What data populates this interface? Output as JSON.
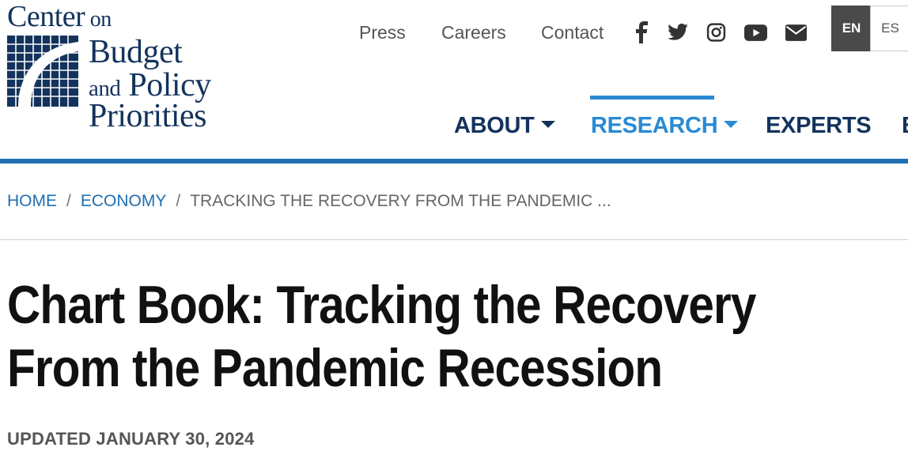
{
  "logo": {
    "line1_main": "Center",
    "line1_small": " on",
    "line2": "Budget",
    "line3_small": "and",
    "line3_main": " Policy",
    "line4": "Priorities"
  },
  "utility_nav": {
    "links": [
      "Press",
      "Careers",
      "Contact"
    ],
    "social_icons": [
      "facebook-icon",
      "twitter-icon",
      "instagram-icon",
      "youtube-icon",
      "email-icon"
    ]
  },
  "language": {
    "options": [
      "EN",
      "ES"
    ],
    "selected": "EN"
  },
  "main_nav": {
    "items": [
      {
        "label": "ABOUT",
        "has_dropdown": true,
        "active": false
      },
      {
        "label": "RESEARCH",
        "has_dropdown": true,
        "active": true
      },
      {
        "label": "EXPERTS",
        "has_dropdown": false,
        "active": false
      },
      {
        "label": "E",
        "has_dropdown": false,
        "active": false
      }
    ]
  },
  "breadcrumb": {
    "items": [
      "HOME",
      "ECONOMY"
    ],
    "separator": "/",
    "current": "TRACKING THE RECOVERY FROM THE PANDEMIC ..."
  },
  "article": {
    "title_line1": "Chart Book: Tracking the Recovery",
    "title_line2": "From the Pandemic Recession",
    "updated": "UPDATED JANUARY 30, 2024"
  },
  "colors": {
    "brand_navy": "#13335c",
    "accent_blue": "#2a8ad4",
    "rule_blue": "#1f6fb2",
    "text_gray": "#555555"
  }
}
